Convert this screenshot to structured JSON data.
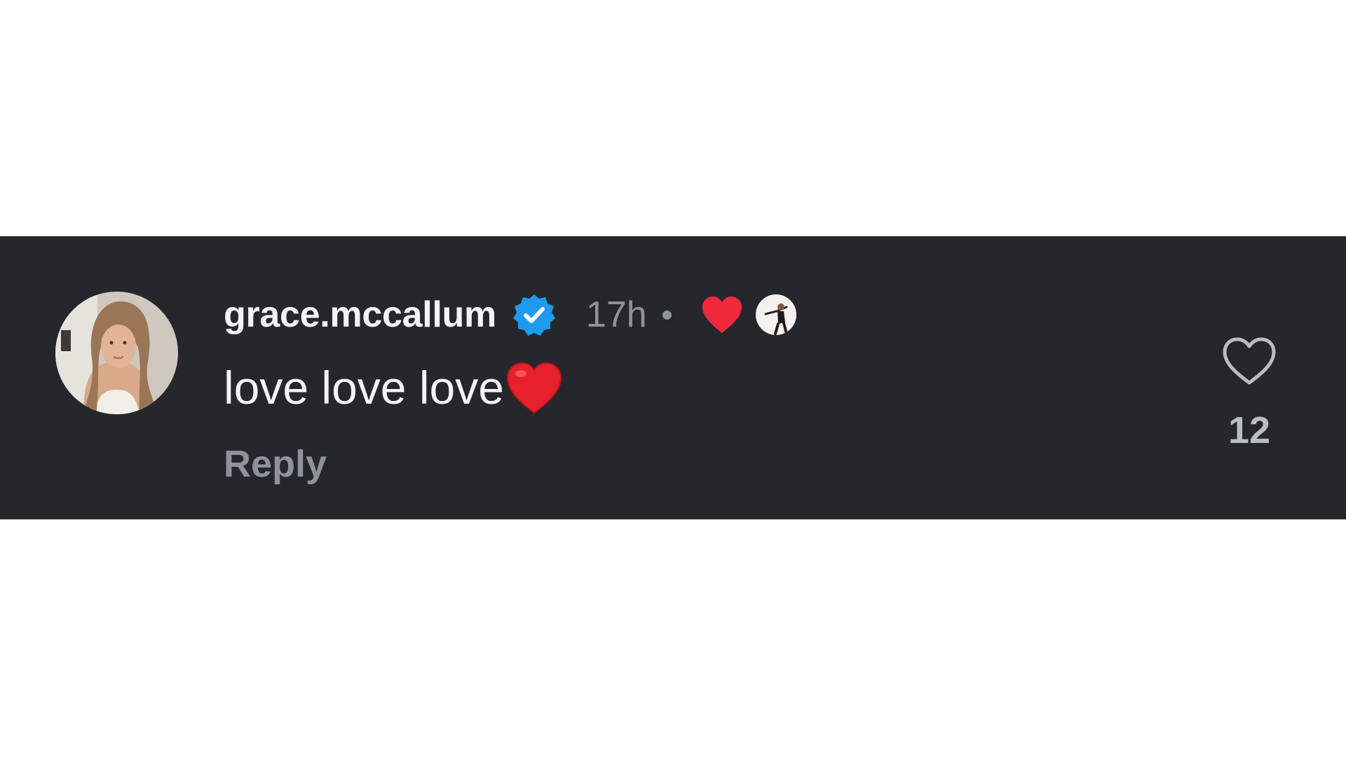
{
  "comment": {
    "username": "grace.mccallum",
    "verified": true,
    "timestamp": "17h",
    "text": "love love love",
    "text_emoji": "red-heart-emoji",
    "reply_label": "Reply",
    "like_count": "12",
    "liked_by_creator": true
  },
  "icons": {
    "verified": "verified-badge-icon",
    "creator_heart": "heart-filled-icon",
    "like": "heart-outline-icon"
  },
  "colors": {
    "background": "#25272c",
    "primary_text": "#f3f4f6",
    "secondary_text": "#8e939b",
    "verified_blue": "#1d9bf0",
    "heart_red": "#f0283c"
  }
}
